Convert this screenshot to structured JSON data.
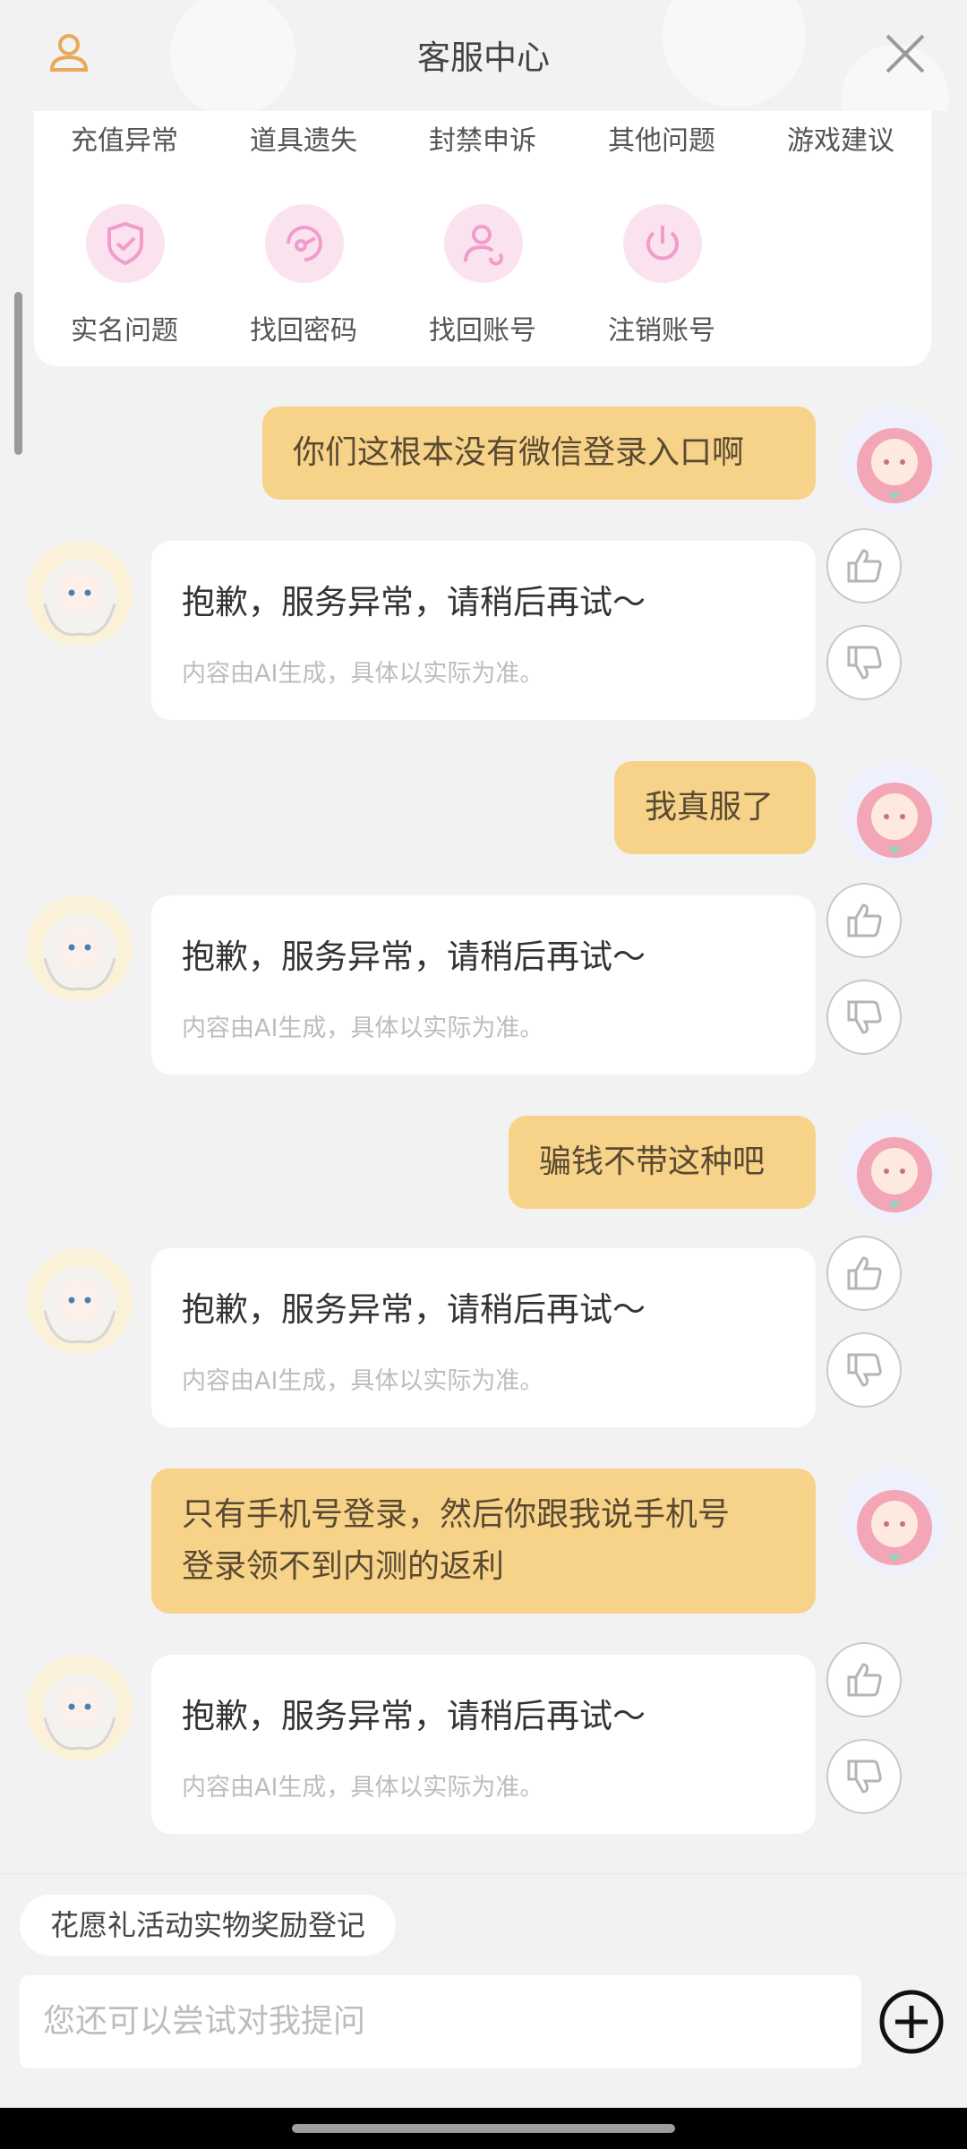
{
  "header": {
    "title": "客服中心",
    "icons": {
      "left": "user-icon",
      "right": "close-icon"
    }
  },
  "categories": {
    "row1": [
      "充值异常",
      "道具遗失",
      "封禁申诉",
      "其他问题",
      "游戏建议"
    ],
    "row2": [
      {
        "label": "实名问题",
        "icon": "shield-check-icon"
      },
      {
        "label": "找回密码",
        "icon": "key-refresh-icon"
      },
      {
        "label": "找回账号",
        "icon": "user-refresh-icon"
      },
      {
        "label": "注销账号",
        "icon": "power-icon"
      }
    ],
    "accent": "#f29ccc"
  },
  "messages": [
    {
      "from": "user",
      "text": "你们这根本没有微信登录入口啊"
    },
    {
      "from": "bot",
      "text": "抱歉，服务异常，请稍后再试～",
      "note": "内容由AI生成，具体以实际为准。"
    },
    {
      "from": "user",
      "text": "我真服了"
    },
    {
      "from": "bot",
      "text": "抱歉，服务异常，请稍后再试～",
      "note": "内容由AI生成，具体以实际为准。"
    },
    {
      "from": "user",
      "text": "骗钱不带这种吧"
    },
    {
      "from": "bot",
      "text": "抱歉，服务异常，请稍后再试～",
      "note": "内容由AI生成，具体以实际为准。"
    },
    {
      "from": "user",
      "text_line1": "只有手机号登录，然后你跟我说手机号",
      "text_line2": "登录领不到内测的返利"
    },
    {
      "from": "bot",
      "text": "抱歉，服务异常，请稍后再试～",
      "note": "内容由AI生成，具体以实际为准。"
    }
  ],
  "suggestion_chip": "花愿礼活动实物奖励登记",
  "input": {
    "placeholder": "您还可以尝试对我提问"
  },
  "colors": {
    "user_bubble": "#f7d38a",
    "bot_bubble": "#ffffff",
    "header_icon": "#e9a85a"
  }
}
